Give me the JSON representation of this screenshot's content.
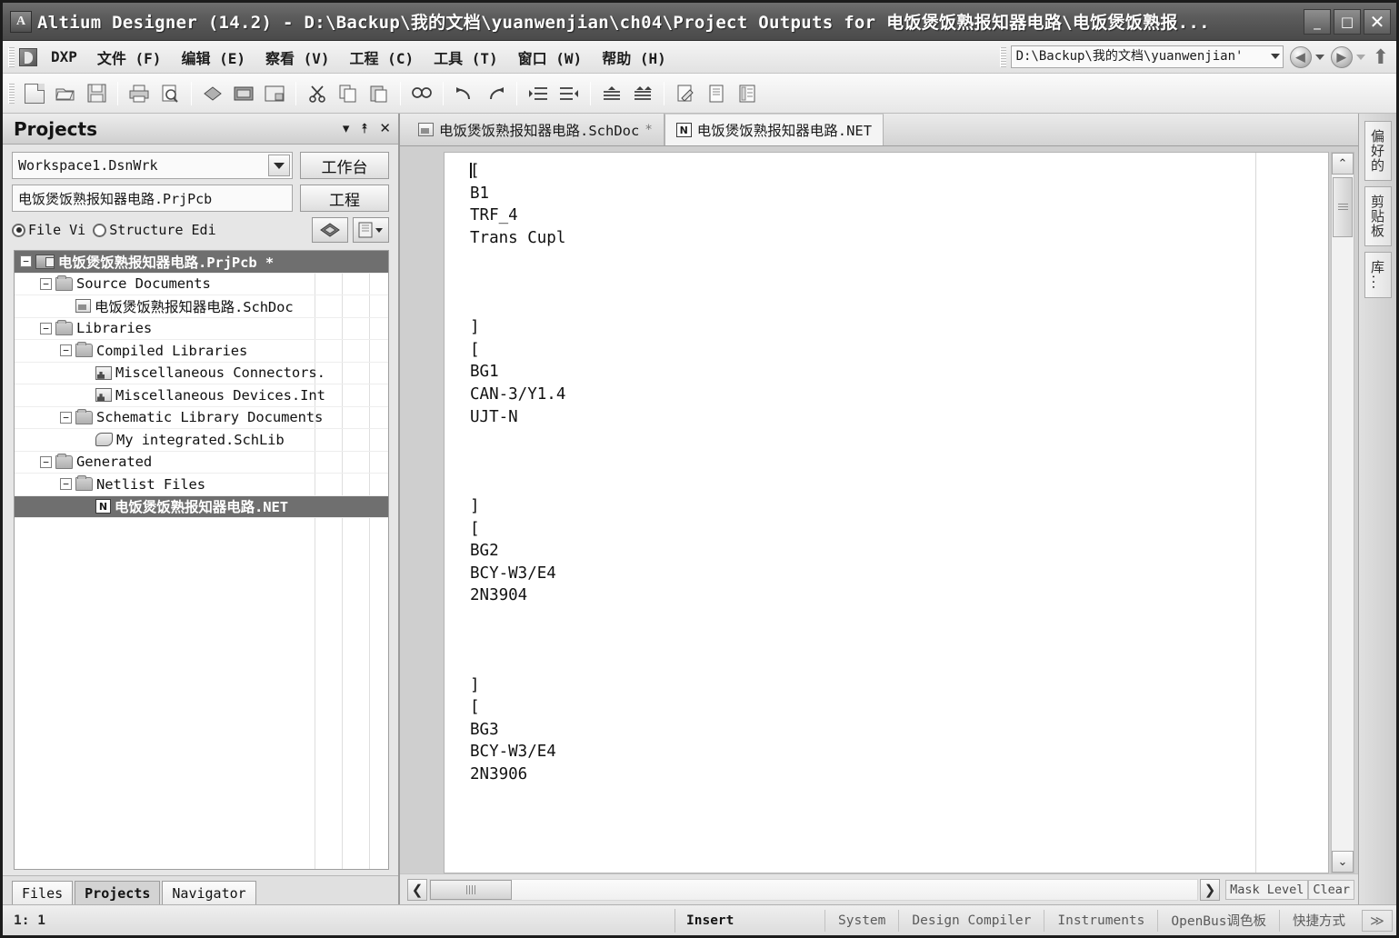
{
  "window": {
    "title": "Altium Designer (14.2) - D:\\Backup\\我的文档\\yuanwenjian\\ch04\\Project Outputs for 电饭煲饭熟报知器电路\\电饭煲饭熟报...",
    "app_icon": "A",
    "minimize": "_",
    "maximize": "□",
    "close": "✕"
  },
  "menubar": {
    "items": [
      {
        "label": "DXP"
      },
      {
        "label": "文件 (F)"
      },
      {
        "label": "编辑 (E)"
      },
      {
        "label": "察看 (V)"
      },
      {
        "label": "工程 (C)"
      },
      {
        "label": "工具 (T)"
      },
      {
        "label": "窗口 (W)"
      },
      {
        "label": "帮助 (H)"
      }
    ],
    "address": {
      "value": "D:\\Backup\\我的文档\\yuanwenjian'",
      "back_label": "◀",
      "forward_label": "▶",
      "up_label": "⬆"
    }
  },
  "toolbar": {
    "groups": [
      [
        "new-document",
        "open-document",
        "save-document"
      ],
      [
        "print-document",
        "print-preview"
      ],
      [
        "board-view",
        "pcb-document",
        "panel-layout"
      ],
      [
        "cut",
        "copy",
        "paste"
      ],
      [
        "find"
      ],
      [
        "undo",
        "redo"
      ],
      [
        "indent-increase",
        "indent-decrease"
      ],
      [
        "align-top",
        "align-spread"
      ],
      [
        "edit-sheet",
        "document-properties",
        "report-list"
      ]
    ]
  },
  "projects_panel": {
    "title": "Projects",
    "controls": {
      "menu": "▾",
      "pin": "⯭",
      "close": "✕"
    },
    "workspace": {
      "value": "Workspace1.DsnWrk",
      "button": "工作台"
    },
    "project": {
      "value": "电饭煲饭熟报知器电路.PrjPcb",
      "button": "工程"
    },
    "view_modes": [
      {
        "label": "File Vi",
        "selected": true
      },
      {
        "label": "Structure Edi",
        "selected": false
      }
    ],
    "tree": [
      {
        "label": "电饭煲饭熟报知器电路.PrjPcb *",
        "indent": 0,
        "expander": "−",
        "icon": "project-icon",
        "selected": true
      },
      {
        "label": "Source Documents",
        "indent": 1,
        "expander": "−",
        "icon": "folder-icon",
        "selected": false
      },
      {
        "label": "电饭煲饭熟报知器电路.SchDoc",
        "indent": 2,
        "expander": "",
        "icon": "schematic-document-icon",
        "selected": false
      },
      {
        "label": "Libraries",
        "indent": 1,
        "expander": "−",
        "icon": "folder-icon",
        "selected": false
      },
      {
        "label": "Compiled Libraries",
        "indent": 2,
        "expander": "−",
        "icon": "folder-icon",
        "selected": false
      },
      {
        "label": "Miscellaneous Connectors.",
        "indent": 3,
        "expander": "",
        "icon": "library-icon",
        "selected": false
      },
      {
        "label": "Miscellaneous Devices.Int",
        "indent": 3,
        "expander": "",
        "icon": "library-icon",
        "selected": false
      },
      {
        "label": "Schematic Library Documents",
        "indent": 2,
        "expander": "−",
        "icon": "folder-icon",
        "selected": false
      },
      {
        "label": "My integrated.SchLib",
        "indent": 3,
        "expander": "",
        "icon": "schlib-icon",
        "selected": false
      },
      {
        "label": "Generated",
        "indent": 1,
        "expander": "−",
        "icon": "folder-icon",
        "selected": false
      },
      {
        "label": "Netlist Files",
        "indent": 2,
        "expander": "−",
        "icon": "folder-icon",
        "selected": false
      },
      {
        "label": "电饭煲饭熟报知器电路.NET",
        "indent": 3,
        "expander": "",
        "icon": "netlist-icon",
        "selected": true
      }
    ],
    "bottom_tabs": [
      {
        "label": "Files",
        "active": false
      },
      {
        "label": "Projects",
        "active": true
      },
      {
        "label": "Navigator",
        "active": false
      }
    ]
  },
  "editor": {
    "tabs": [
      {
        "label": "电饭煲饭熟报知器电路.SchDoc",
        "modified": "*",
        "icon": "schematic-document-icon",
        "active": false
      },
      {
        "label": "电饭煲饭熟报知器电路.NET",
        "modified": "",
        "icon": "netlist-icon",
        "active": true
      }
    ],
    "netlist_text": "[\nB1\nTRF_4\nTrans Cupl\n\n\n\n]\n[\nBG1\nCAN-3/Y1.4\nUJT-N\n\n\n\n]\n[\nBG2\nBCY-W3/E4\n2N3904\n\n\n\n]\n[\nBG3\nBCY-W3/E4\n2N3906\n",
    "mask": {
      "level_label": "Mask Level",
      "clear_label": "Clear"
    },
    "scroll": {
      "up": "⌃",
      "down": "⌄",
      "left": "❮",
      "right": "❯"
    }
  },
  "right_dock": {
    "tabs": [
      {
        "label": "偏好的"
      },
      {
        "label": "剪贴板"
      },
      {
        "label": "库..."
      }
    ]
  },
  "statusbar": {
    "coordinate": "1: 1",
    "mode": "Insert",
    "panels": [
      {
        "label": "System"
      },
      {
        "label": "Design Compiler"
      },
      {
        "label": "Instruments"
      },
      {
        "label": "OpenBus调色板"
      },
      {
        "label": "快捷方式"
      }
    ],
    "overflow": "≫"
  },
  "colors": {
    "titlebar": "#5b5b5b",
    "selection": "#6f6f6f",
    "panel_bg": "#e6e6e6",
    "editor_bg": "#ffffff"
  }
}
